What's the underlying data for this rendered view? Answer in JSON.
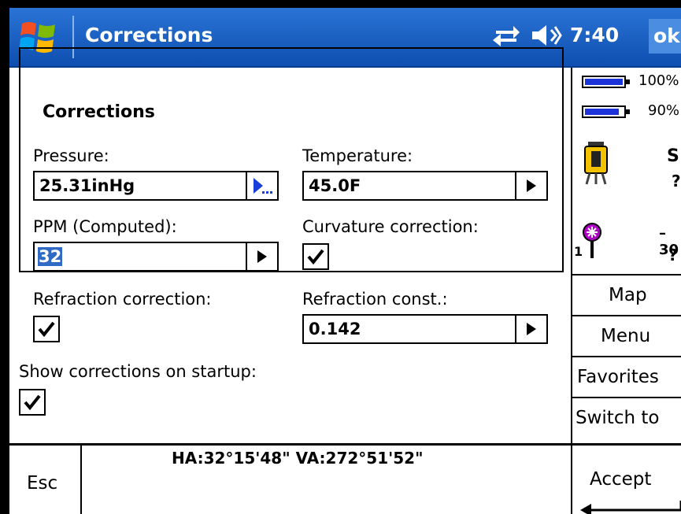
{
  "titlebar": {
    "title": "Corrections",
    "clock": "7:40",
    "ok_label": "ok"
  },
  "group": {
    "title": "Corrections"
  },
  "fields": {
    "pressure_label": "Pressure:",
    "pressure_value": "25.31inHg",
    "temperature_label": "Temperature:",
    "temperature_value": "45.0F",
    "ppm_label": "PPM (Computed):",
    "ppm_value": "32",
    "curvature_label": "Curvature correction:",
    "curvature_checked": true,
    "refraction_label": "Refraction correction:",
    "refraction_checked": true,
    "refraction_const_label": "Refraction const.:",
    "refraction_const_value": "0.142"
  },
  "startup": {
    "label": "Show corrections on startup:",
    "checked": true
  },
  "status": {
    "battery1_pct": "100%",
    "battery1_level": 1.0,
    "battery2_pct": "90%",
    "battery2_level": 0.9,
    "instrument_letter": "S",
    "instrument_q": "?",
    "prism_value": "–30",
    "prism_q": "?",
    "prism_number": "1"
  },
  "sidebar": {
    "map": "Map",
    "menu": "Menu",
    "favorites": "Favorites",
    "switch_to": "Switch to"
  },
  "bottombar": {
    "esc": "Esc",
    "angles": "HA:32°15'48\"  VA:272°51'52\"",
    "accept": "Accept"
  },
  "colors": {
    "titlebar": "#1d63c6",
    "selection": "#316ac5",
    "battery": "#1c33d8",
    "prism": "#b000c8"
  },
  "icons": [
    "windows-logo-icon",
    "sync-icon",
    "volume-icon",
    "arrow-right-icon",
    "ellipsis-arrow-icon",
    "checkmark-icon",
    "total-station-icon",
    "prism-icon",
    "battery-icon"
  ]
}
